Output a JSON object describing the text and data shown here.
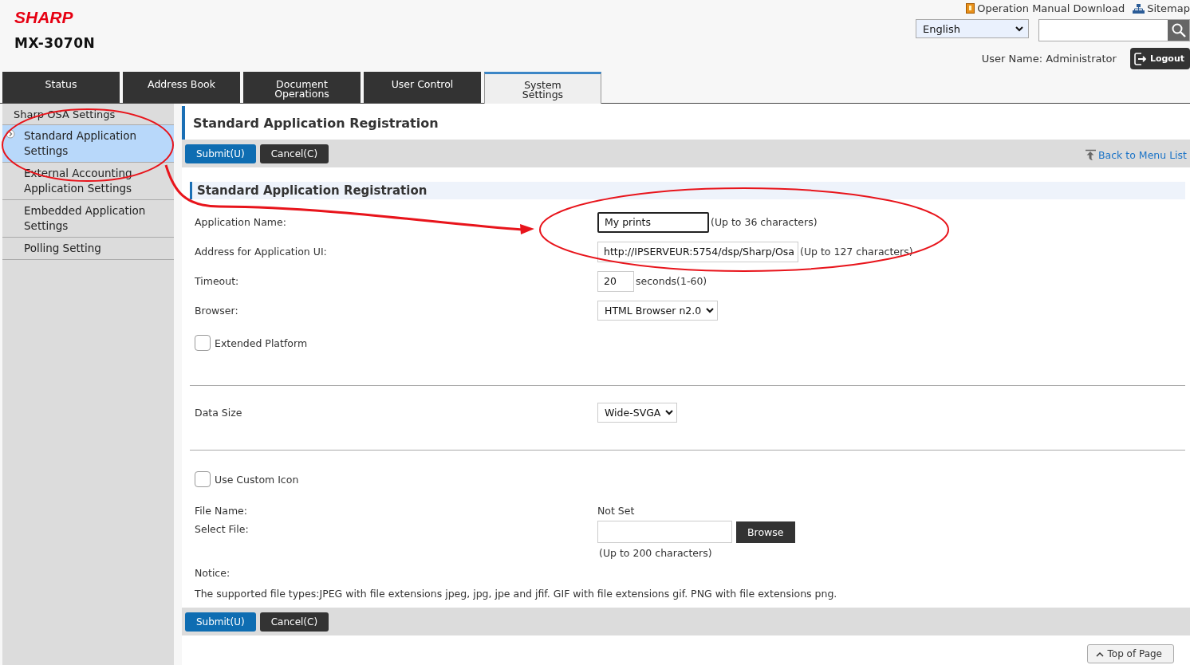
{
  "header": {
    "brand": "SHARP",
    "model": "MX-3070N",
    "links": [
      {
        "kind": "manual",
        "label": "Operation Manual Download"
      },
      {
        "kind": "sitemap",
        "label": "Sitemap"
      }
    ],
    "language": "English",
    "user_name": "User Name: Administrator",
    "logout": "Logout"
  },
  "tabs": [
    {
      "label": "Status",
      "selected": false
    },
    {
      "label": "Address Book",
      "selected": false
    },
    {
      "label": "Document\nOperations",
      "selected": false
    },
    {
      "label": "User Control",
      "selected": false
    },
    {
      "label": "System\nSettings",
      "selected": true
    }
  ],
  "sidebar": {
    "heading": "Sharp OSA Settings",
    "items": [
      {
        "label": "Standard Application Settings",
        "selected": true
      },
      {
        "label": "External Accounting Application Settings",
        "selected": false
      },
      {
        "label": "Embedded Application Settings",
        "selected": false
      },
      {
        "label": "Polling Setting",
        "selected": false
      }
    ]
  },
  "page_title": "Standard Application Registration",
  "top_buttons": [
    {
      "kind": "primary",
      "label": "Submit(U)"
    },
    {
      "kind": "secondary",
      "label": "Cancel(C)"
    }
  ],
  "back_link": "Back to Menu List",
  "section_title": "Standard Application Registration",
  "sections": [
    {
      "rows": [
        {
          "kind": "text",
          "label": "Application Name:",
          "value": "My prints",
          "note": "(Up to 36 characters)",
          "focused": true
        },
        {
          "kind": "text",
          "label": "Address for Application UI:",
          "value": "http://IPSERVEUR:5754/dsp/Sharp/Osa",
          "note": "(Up to 127 characters)",
          "focused": false
        },
        {
          "kind": "number",
          "label": "Timeout:",
          "value": "20",
          "note": "seconds(1-60)"
        },
        {
          "kind": "select",
          "label": "Browser:",
          "value": "HTML Browser n2.0"
        },
        {
          "kind": "checkbox",
          "label": "Extended Platform",
          "checked": false
        }
      ]
    },
    {
      "rows": [
        {
          "kind": "select",
          "label": "Data Size",
          "value": "Wide-SVGA"
        }
      ]
    },
    {
      "rows": [
        {
          "kind": "checkbox",
          "label": "Use Custom Icon",
          "checked": false
        },
        {
          "kind": "static",
          "label": "File Name:",
          "value": "Not Set"
        },
        {
          "kind": "file",
          "label": "Select File:",
          "button": "Browse",
          "note": "(Up to 200 characters)"
        },
        {
          "kind": "notice",
          "label": "Notice:",
          "text": "The supported file types:JPEG with file extensions jpeg, jpg, jpe and jfif. GIF with file extensions gif. PNG with file extensions png."
        }
      ]
    }
  ],
  "bottom_buttons": [
    {
      "kind": "primary",
      "label": "Submit(U)"
    },
    {
      "kind": "secondary",
      "label": "Cancel(C)"
    }
  ],
  "top_of_page": "Top of Page",
  "annotations": [
    {
      "kind": "ellipse"
    },
    {
      "kind": "ellipse"
    },
    {
      "kind": "arrow"
    }
  ]
}
